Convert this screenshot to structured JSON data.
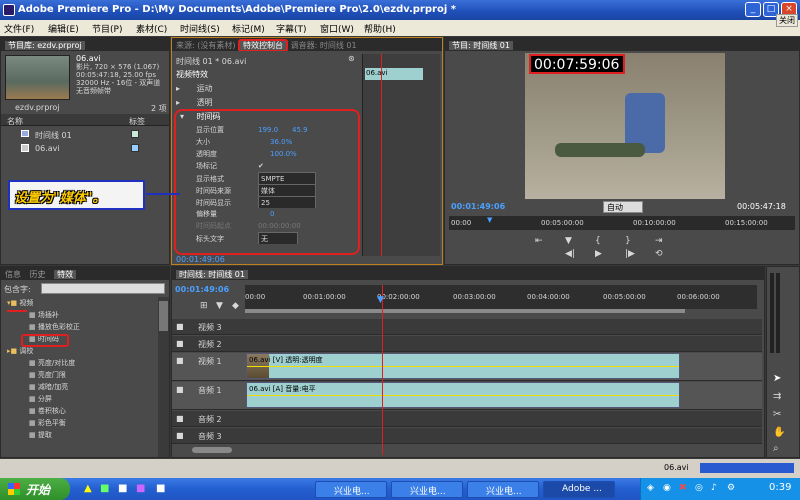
{
  "window": {
    "title": "Adobe Premiere Pro - D:\\My Documents\\Adobe\\Premiere Pro\\2.0\\ezdv.prproj *",
    "minimize": "_",
    "maximize": "□",
    "close": "×",
    "close_tooltip": "关闭"
  },
  "menu": [
    "文件(F)",
    "编辑(E)",
    "节目(P)",
    "素材(C)",
    "时间线(S)",
    "标记(M)",
    "字幕(T)",
    "窗口(W)",
    "帮助(H)"
  ],
  "project": {
    "tab": "节目库: ezdv.prproj",
    "file_name": "06.avi",
    "info1": "影片, 720 × 576 (1.067)",
    "info2": "00:05:47:18, 25.00 fps",
    "info3": "32000 Hz - 16位 - 双声道",
    "info4": "无音频帧带",
    "project_name": "ezdv.prproj",
    "item_count": "2 项",
    "col_name": "名称",
    "col_label": "标签",
    "items": [
      "时间线 01",
      "06.avi"
    ]
  },
  "effect_controls": {
    "tab_source": "来源: (没有素材)",
    "tab_effect": "特效控制台",
    "tab_mixer": "调音器: 时间线 01",
    "clip_path": "时间线 01 * 06.avi",
    "clip_label": "06.avi",
    "section": "视频特效",
    "motion": "运动",
    "opacity": "透明",
    "timecode": "时间码",
    "params": [
      {
        "name": "显示位置",
        "value": "199.0",
        "value2": "45.9"
      },
      {
        "name": "大小",
        "value": "36.0%"
      },
      {
        "name": "透明度",
        "value": "100.0%"
      },
      {
        "name": "场标记",
        "value": "✔"
      },
      {
        "name": "显示格式",
        "value": "SMPTE"
      },
      {
        "name": "时间码来源",
        "value": "媒体"
      },
      {
        "name": "时间码显示",
        "value": "25"
      },
      {
        "name": "偏移量",
        "value": "0"
      },
      {
        "name": "时间码起点",
        "value": "00:00:00:00"
      },
      {
        "name": "标头文字",
        "value": "无"
      }
    ],
    "time": "00:01:49:06"
  },
  "annotation": {
    "text": "设置为\"媒体\"。"
  },
  "program": {
    "tab": "节目: 时间线 01",
    "overlay_timecode": "00:07:59:06",
    "current_time": "00:01:49:06",
    "fit": "自动",
    "duration": "00:05:47:18",
    "ruler": [
      "00:00",
      "00:05:00:00",
      "00:10:00:00",
      "00:15:00:00"
    ]
  },
  "effects_panel": {
    "tabs": [
      "信息",
      "历史",
      "特效"
    ],
    "search_label": "包含字:",
    "tree": [
      {
        "label": "视频",
        "indent": 1,
        "folder": true
      },
      {
        "label": "场插补",
        "indent": 2
      },
      {
        "label": "播放色彩校正",
        "indent": 2
      },
      {
        "label": "时间码",
        "indent": 2
      },
      {
        "label": "调校",
        "indent": 1,
        "folder": true
      },
      {
        "label": "亮度/对比度",
        "indent": 2
      },
      {
        "label": "亮度门限",
        "indent": 2
      },
      {
        "label": "减暗/加亮",
        "indent": 2
      },
      {
        "label": "分屏",
        "indent": 2
      },
      {
        "label": "卷积核心",
        "indent": 2
      },
      {
        "label": "彩色平衡",
        "indent": 2
      },
      {
        "label": "提取",
        "indent": 2
      }
    ]
  },
  "timeline": {
    "tab": "时间线: 时间线 01",
    "time": "00:01:49:06",
    "ruler": [
      "00:00",
      "00:01:00:00",
      "00:02:00:00",
      "00:03:00:00",
      "00:04:00:00",
      "00:05:00:00",
      "00:06:00:00"
    ],
    "tracks": [
      "视频 3",
      "视频 2",
      "视频 1",
      "音频 1",
      "音频 2",
      "音频 3"
    ],
    "video_clip": "06.avi [V] 透明:透明度",
    "audio_clip": "06.avi [A] 音量:电平"
  },
  "statusbar": {
    "file": "06.avi"
  },
  "taskbar": {
    "start": "开始",
    "items": [
      "兴业电...",
      "兴业电...",
      "兴业电...",
      "Adobe ..."
    ],
    "time": "0:39"
  },
  "colors": {
    "accent_red": "#e02020",
    "annotation_text": "#ffcc00",
    "annotation_border": "#2030c0",
    "blue_value": "#4aa0ff"
  }
}
